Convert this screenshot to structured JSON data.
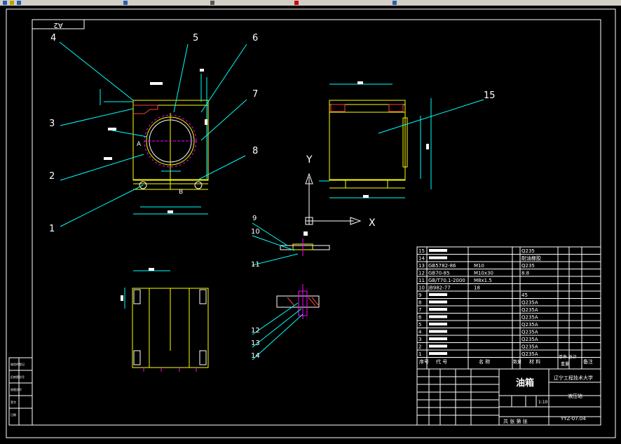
{
  "drawing": {
    "sheet_code": "A2",
    "callouts": [
      "1",
      "2",
      "3",
      "4",
      "5",
      "6",
      "7",
      "8",
      "9",
      "10",
      "11",
      "12",
      "13",
      "14",
      "15"
    ],
    "section_labels": [
      "A",
      "B"
    ],
    "axes": {
      "y": "Y",
      "x": "X"
    }
  },
  "bom": {
    "rows": [
      {
        "no": "15",
        "material": "Q235"
      },
      {
        "no": "14",
        "material": "耐油橡胶"
      },
      {
        "no": "13",
        "code": "GB5782-86",
        "spec": "M10",
        "material": "Q235"
      },
      {
        "no": "12",
        "code": "GB70-85",
        "spec": "M10x30",
        "material": "8.8"
      },
      {
        "no": "11",
        "code": "GB/T70.1-2000",
        "spec": "M8x1.5",
        "material": ""
      },
      {
        "no": "10",
        "code": "JB982-77",
        "spec": "18",
        "material": ""
      },
      {
        "no": "9",
        "material": "45"
      },
      {
        "no": "8",
        "material": "Q235A"
      },
      {
        "no": "7",
        "material": "Q235A"
      },
      {
        "no": "6",
        "material": "Q235A"
      },
      {
        "no": "5",
        "material": "Q235A"
      },
      {
        "no": "4",
        "material": "Q235A"
      },
      {
        "no": "3",
        "material": "Q235A"
      },
      {
        "no": "2",
        "material": "Q235A"
      },
      {
        "no": "1",
        "material": "Q235A"
      }
    ],
    "header": {
      "seq": "序号",
      "code": "代 号",
      "name": "名 称",
      "qty": "数量",
      "material": "材 料",
      "weight": "单件 总计",
      "unit": "重量",
      "remark": "备注"
    }
  },
  "title_block": {
    "part_name": "油箱",
    "school": "辽宁工程技术大学",
    "project": "液压站",
    "drawing_no": "YYZ-07.04",
    "scale": "1:10",
    "sheet_info": "共 张 第 张"
  },
  "side_block": {
    "labels": [
      "借用件登记",
      "旧底图总号",
      "底图总号",
      "签字",
      "日期"
    ]
  }
}
